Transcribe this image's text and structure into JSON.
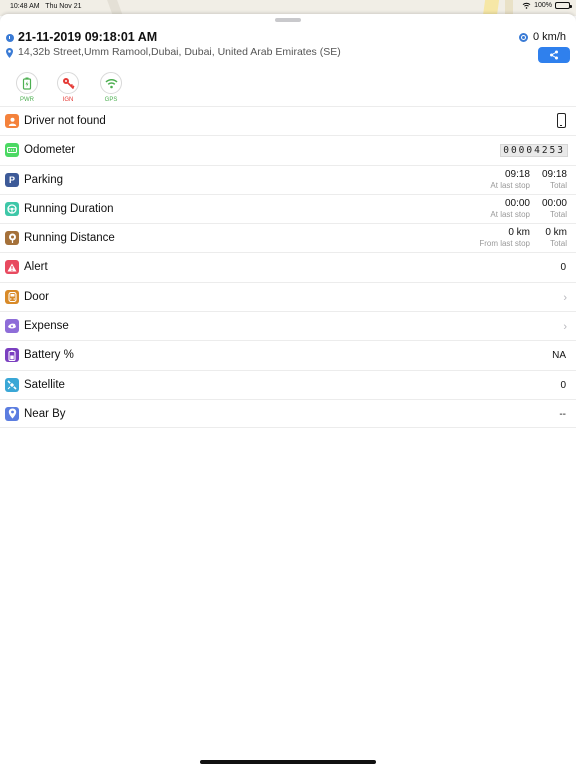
{
  "status_bar": {
    "time": "10:48 AM",
    "date": "Thu Nov 21",
    "battery": "100%",
    "battery_level": 1.0
  },
  "header": {
    "datetime": "21-11-2019 09:18:01 AM",
    "speed": "0 km/h",
    "address": "14,32b Street,Umm Ramool,Dubai, Dubai, United Arab Emirates (SE)"
  },
  "share": {
    "icon": "share-icon"
  },
  "status_icons": [
    {
      "label": "PWR",
      "color": "#4caf50",
      "icon": "battery-icon"
    },
    {
      "label": "IGN",
      "color": "#e53935",
      "icon": "key-icon"
    },
    {
      "label": "GPS",
      "color": "#4caf50",
      "icon": "wifi-signal-icon"
    }
  ],
  "colors": {
    "accent": "#2f80ed"
  },
  "rows": {
    "driver": {
      "label": "Driver not found",
      "icon": "driver-icon",
      "color": "#f4823c",
      "trailing_icon": "phone-icon"
    },
    "odometer": {
      "label": "Odometer",
      "value": "00004253",
      "icon": "odometer-icon",
      "color": "#4cd964"
    },
    "parking": {
      "label": "Parking",
      "value_a": "09:18",
      "sub_a": "At last stop",
      "value_b": "09:18",
      "sub_b": "Total",
      "icon": "parking-icon",
      "color": "#3d5a98"
    },
    "running_duration": {
      "label": "Running Duration",
      "value_a": "00:00",
      "sub_a": "At last stop",
      "value_b": "00:00",
      "sub_b": "Total",
      "icon": "steering-icon",
      "color": "#3ec7a8"
    },
    "running_distance": {
      "label": "Running Distance",
      "value_a": "0 km",
      "sub_a": "From last stop",
      "value_b": "0 km",
      "sub_b": "Total",
      "icon": "distance-icon",
      "color": "#a5713a"
    },
    "alert": {
      "label": "Alert",
      "value": "0",
      "icon": "alert-icon",
      "color": "#e84a5f"
    },
    "door": {
      "label": "Door",
      "icon": "door-icon",
      "color": "#d88a28"
    },
    "expense": {
      "label": "Expense",
      "icon": "expense-icon",
      "color": "#8e6dd8"
    },
    "battery": {
      "label": "Battery %",
      "value": "NA",
      "icon": "battery-icon",
      "color": "#7b3fc0"
    },
    "satellite": {
      "label": "Satellite",
      "value": "0",
      "icon": "satellite-icon",
      "color": "#3aa7d6"
    },
    "nearby": {
      "label": "Near By",
      "value": "--",
      "icon": "location-icon",
      "color": "#5b7de0"
    }
  }
}
